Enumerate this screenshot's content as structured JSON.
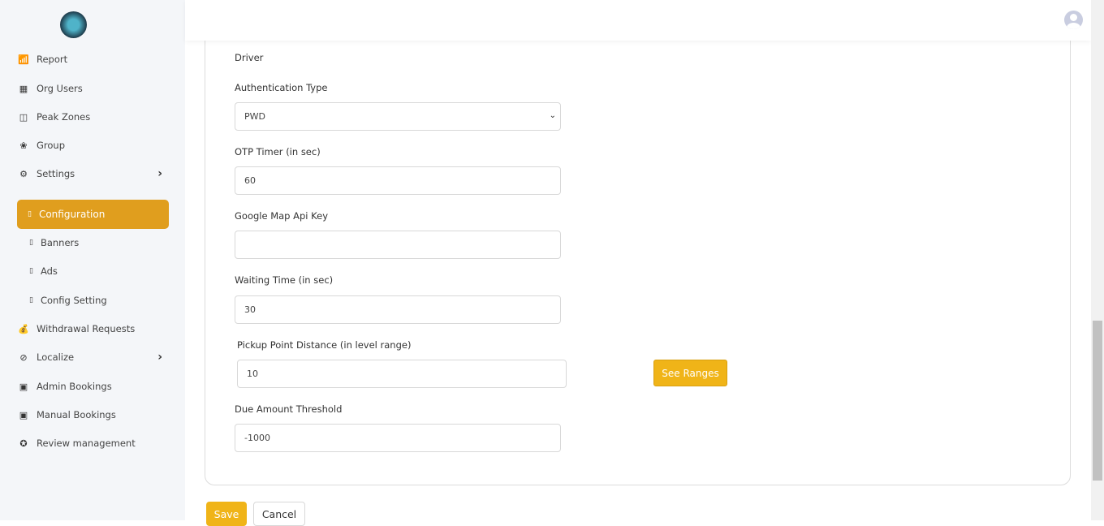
{
  "sidebar": {
    "items": [
      {
        "label": "Report",
        "icon": "chart-icon"
      },
      {
        "label": "Org Users",
        "icon": "building-icon"
      },
      {
        "label": "Peak Zones",
        "icon": "map-icon"
      },
      {
        "label": "Group",
        "icon": "group-icon"
      },
      {
        "label": "Settings",
        "icon": "gear-icon"
      },
      {
        "label": "Withdrawal Requests",
        "icon": "money-bag-icon"
      },
      {
        "label": "Localize",
        "icon": "compass-icon"
      },
      {
        "label": "Admin Bookings",
        "icon": "calendar-check-icon"
      },
      {
        "label": "Manual Bookings",
        "icon": "calendar-check-icon"
      },
      {
        "label": "Review management",
        "icon": "review-icon"
      }
    ],
    "sub_items": [
      {
        "label": "Configuration",
        "active": true
      },
      {
        "label": "Banners"
      },
      {
        "label": "Ads"
      },
      {
        "label": "Config Setting"
      }
    ]
  },
  "form": {
    "section_title": "Driver",
    "auth_type": {
      "label": "Authentication Type",
      "value": "PWD"
    },
    "otp_timer": {
      "label": "OTP Timer (in sec)",
      "value": "60"
    },
    "google_key": {
      "label": "Google Map Api Key",
      "value": ""
    },
    "waiting_time": {
      "label": "Waiting Time (in sec)",
      "value": "30"
    },
    "pickup_distance": {
      "label": "Pickup Point Distance (in level range)",
      "value": "10"
    },
    "see_ranges": "See Ranges",
    "due_amount": {
      "label": "Due Amount Threshold",
      "value": "-1000"
    }
  },
  "actions": {
    "save": "Save",
    "cancel": "Cancel"
  },
  "colors": {
    "accent": "#e09e1e",
    "button": "#f0b418"
  }
}
